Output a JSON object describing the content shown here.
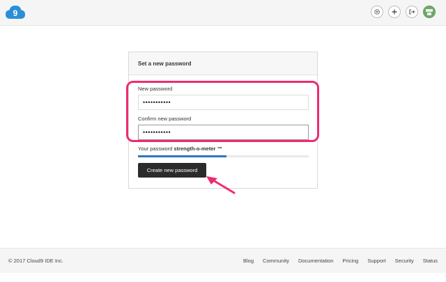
{
  "header": {
    "logo_text": "9",
    "icons": [
      "gear-icon",
      "plus-icon",
      "sign-out-icon",
      "avatar"
    ]
  },
  "card": {
    "title": "Set a new password",
    "new_password": {
      "label": "New password",
      "value": "•••••••••••"
    },
    "confirm_password": {
      "label": "Confirm new password",
      "value": "•••••••••••"
    },
    "strength": {
      "prefix": "Your password ",
      "emphasis": "strength-o-meter ™",
      "level": 0.52
    },
    "submit_label": "Create new password"
  },
  "footer": {
    "copyright": "© 2017 Cloud9 IDE Inc.",
    "links": [
      "Blog",
      "Community",
      "Documentation",
      "Pricing",
      "Support",
      "Security",
      "Status"
    ]
  },
  "colors": {
    "annotation": "#ee2b72",
    "brand": "#2b8fd6",
    "strength_fill": "#2b78be"
  }
}
